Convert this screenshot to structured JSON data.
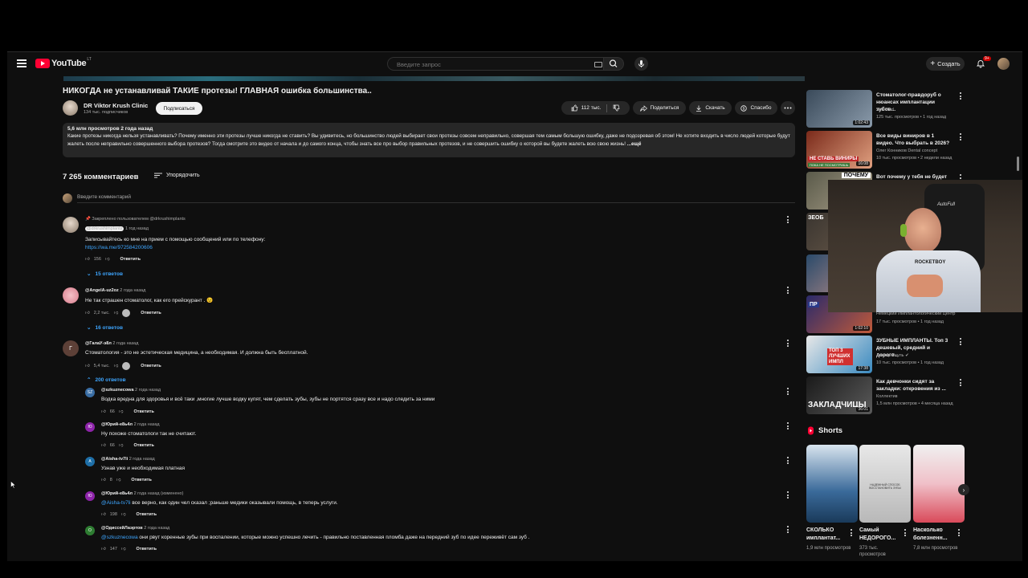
{
  "topbar": {
    "logo_text": "YouTube",
    "logo_country": "LT",
    "search_placeholder": "Введите запрос",
    "create_label": "Создать",
    "notifications_badge": "9+"
  },
  "video": {
    "title": "НИКОГДА не устанавливай ТАКИЕ протезы! ГЛАВНАЯ ошибка большинства..",
    "channel_name": "DR Viktor Krush Clinic",
    "channel_subs": "134 тыс. подписчиков",
    "subscribe_label": "Подписаться",
    "likes": "112 тыс.",
    "share_label": "Поделиться",
    "download_label": "Скачать",
    "thanks_label": "Спасибо"
  },
  "description": {
    "meta": "5,6 млн просмотров  2 года назад",
    "text": "Какие протезы никогда нельзя устанавливать? Почему именно эти протезы лучше никогда не ставить? Вы удивитесь, но большинство людей выбирает свои протезы совсем неправильно, совершая тем самым большую ошибку, даже не подозревая об этом! Не хотите входить в число людей которые будут жалеть после неправильно совершенного выбора протезов? Тогда смотрите это видео от начала и до самого конца, чтобы знать все про выбор правильных протезов, и не совершить ошибку о которой вы будете жалеть всю свою жизнь!",
    "more": "...ещё"
  },
  "comments_section": {
    "count": "7 265 комментариев",
    "sort_label": "Упорядочить",
    "add_placeholder": "Введите комментарий"
  },
  "comments": [
    {
      "pinned": "Закреплено пользователем @drkrushimplants",
      "author": "@drkrushimplants",
      "time": "1 год назад",
      "text": "Записывайтесь ко мне на прием с помощью сообщений или по телефону:",
      "link": "https://wa.me/972584200606",
      "likes": "156",
      "reply": "Ответить",
      "replies": "15 ответов"
    },
    {
      "author": "@AngelA-uz2oz",
      "time": "2 года назад",
      "text": "Не так страшен стоматолог, как его прейскурант . 😉",
      "likes": "2,2 тыс.",
      "reply": "Ответить",
      "replies": "16 ответов"
    },
    {
      "author": "@ГалаУ-э8л",
      "avatar_letter": "Г",
      "time": "2 года назад",
      "text": "Стоматология - это не эстетическая медицина, а необходимая. И должна быть бесплатной.",
      "likes": "5,4 тыс.",
      "reply": "Ответить",
      "replies": "200 ответов"
    }
  ],
  "replies": [
    {
      "author": "@szkuznecowa",
      "avatar_letter": "SZ",
      "avatar_color": "#3a6ea5",
      "time": "2 года назад",
      "mention": "",
      "text": "Водка вредна для здоровья и всё таки ,многие лучше водку купят, чем сделать зубы, зубы не портятся сразу все и надо следить за ними",
      "likes": "66",
      "reply": "Ответить"
    },
    {
      "author": "@Юрий-е8ь4л",
      "avatar_letter": "Ю",
      "avatar_color": "#8e24aa",
      "time": "2 года назад",
      "mention": "",
      "text": "Ну похоже стоматологи так не считают.",
      "likes": "66",
      "reply": "Ответить"
    },
    {
      "author": "@Aisha-tv7li",
      "avatar_letter": "A",
      "avatar_color": "#1e6fa8",
      "time": "2 года назад",
      "mention": "",
      "text": "Узнав уже и необходимая платная",
      "likes": "8",
      "reply": "Ответить"
    },
    {
      "author": "@Юрий-е8ь4л",
      "avatar_letter": "Ю",
      "avatar_color": "#8e24aa",
      "time": "2 года назад (изменено)",
      "mention": "@Aisha-tv7li",
      "text": " все верно, как один чел сказал ;раньше медики оказывали помощь, в теперь услуги.",
      "likes": "198",
      "reply": "Ответить"
    },
    {
      "author": "@ОдиссейЛаэртов",
      "avatar_letter": "O",
      "avatar_color": "#2e7d32",
      "time": "2 года назад",
      "mention": "@szkuznecowa",
      "text": "  они рвут коренные зубы при воспалении, которые можно  успешно лечить - правильно поставленная пломба даже на передний зуб по идее переживёт сам зуб .",
      "likes": "147",
      "reply": "Ответить"
    }
  ],
  "sidebar": [
    {
      "title": "Стоматолог-правдоруб о нюансах имплантации зубов...",
      "channel": "YourMed",
      "stats": "125 тыс. просмотров • 1 год назад",
      "duration": "1:02:43",
      "color": "#5a6b7a"
    },
    {
      "title": "Все виды виниров в 1 видео. Что выбрать в 2026?",
      "channel": "Олег Конников Dental concept",
      "stats": "10 тыс. просмотров • 2 недели назад",
      "duration": "16:08",
      "color": "#c94a3a"
    },
    {
      "title": "Вот почему у тебя не будет",
      "channel": "",
      "stats": "",
      "duration": "",
      "color": "#7a7a6a"
    },
    {
      "title": "",
      "channel": "",
      "stats": "",
      "duration": "",
      "color": "#5a5048"
    },
    {
      "title": "",
      "channel": "",
      "stats": "",
      "duration": "",
      "color": "#6a5a5a"
    },
    {
      "title": "",
      "channel": "Немецкий Имплантологический Центр",
      "stats": "17 тыс. просмотров • 1 год назад",
      "duration": "1:02:10",
      "color": "#4a5a8a"
    },
    {
      "title": "ЗУБНЫЕ ИМПЛАНТЫ. Топ 3 дешевый, средний и дорого...",
      "channel": "Доктор Реуль",
      "stats": "10 тыс. просмотров • 1 год назад",
      "duration": "17:38",
      "color": "#3a8ac0"
    },
    {
      "title": "Как девчонки сидят за закладки: откровения из ...",
      "channel": "Коллектив",
      "stats": "1,5 млн просмотров • 4 месяца назад",
      "duration": "36:01",
      "color": "#3a3a3a"
    }
  ],
  "sidebar_overlays": {
    "thumb2_text": "НЕ СТАВЬ ВИНИРЫ",
    "thumb2_sub": "ПОКА НЕ ПОСМОТРИШЬ",
    "thumb3_text": "ПОЧЕМУ",
    "thumb4_text": "ЗЕОБ",
    "thumb6_text": "ПР",
    "thumb7_text": "ТОП 3 ЛУЧШИХ ИМПЛ",
    "thumb8_text": "ЗАКЛАДЧИЦЫ"
  },
  "shorts": {
    "title": "Shorts",
    "items": [
      {
        "title": "СКОЛЬКО имплантат...",
        "views": "1,9 млн просмотров",
        "color": "#3a6a9a"
      },
      {
        "title": "Самый НЕДОРОГО...",
        "views": "373 тыс. просмотров",
        "color": "#6a6a6a"
      },
      {
        "title": "Насколько болезненн...",
        "views": "7,8 млн просмотров",
        "color": "#d94a5a"
      }
    ],
    "item2_caption": "НАДЕЖНЫЙ СПОСОБ ВОССТАНОВИТЬ ЗУБЫ"
  },
  "webcam": {
    "shirt_text": "ROCKETBOY",
    "brand_text": "AutoFull"
  }
}
